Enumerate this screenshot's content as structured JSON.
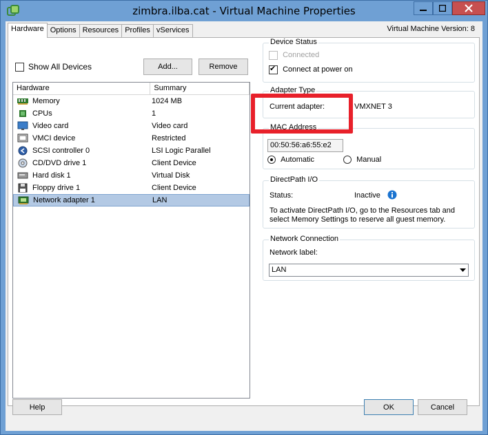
{
  "window": {
    "title": "zimbra.ilba.cat - Virtual Machine Properties",
    "vm_version": "Virtual Machine Version: 8"
  },
  "tabs": [
    {
      "label": "Hardware",
      "active": true
    },
    {
      "label": "Options",
      "active": false
    },
    {
      "label": "Resources",
      "active": false
    },
    {
      "label": "Profiles",
      "active": false
    },
    {
      "label": "vServices",
      "active": false
    }
  ],
  "hardware": {
    "show_all_label": "Show All Devices",
    "show_all_checked": false,
    "add_label": "Add...",
    "remove_label": "Remove",
    "columns": [
      "Hardware",
      "Summary"
    ],
    "devices": [
      {
        "name": "Memory",
        "summary": "1024 MB",
        "icon": "memory-icon"
      },
      {
        "name": "CPUs",
        "summary": "1",
        "icon": "cpu-icon"
      },
      {
        "name": "Video card",
        "summary": "Video card",
        "icon": "video-card-icon"
      },
      {
        "name": "VMCI device",
        "summary": "Restricted",
        "icon": "vmci-icon"
      },
      {
        "name": "SCSI controller 0",
        "summary": "LSI Logic Parallel",
        "icon": "scsi-icon"
      },
      {
        "name": "CD/DVD drive 1",
        "summary": "Client Device",
        "icon": "cd-dvd-icon"
      },
      {
        "name": "Hard disk 1",
        "summary": "Virtual Disk",
        "icon": "hard-disk-icon"
      },
      {
        "name": "Floppy drive 1",
        "summary": "Client Device",
        "icon": "floppy-icon"
      },
      {
        "name": "Network adapter 1",
        "summary": "LAN",
        "icon": "network-adapter-icon",
        "selected": true
      }
    ]
  },
  "device_status": {
    "label": "Device Status",
    "connected_label": "Connected",
    "connected_checked": false,
    "connect_power_label": "Connect at power on",
    "connect_power_checked": true
  },
  "adapter_type": {
    "label": "Adapter Type",
    "current_label": "Current adapter:",
    "current_value": "VMXNET 3"
  },
  "mac_address": {
    "label": "MAC Address",
    "value": "00:50:56:a6:55:e2",
    "automatic_label": "Automatic",
    "manual_label": "Manual",
    "selected": "Automatic"
  },
  "directpath": {
    "label": "DirectPath I/O",
    "status_label": "Status:",
    "status_value": "Inactive",
    "note": "To activate DirectPath I/O, go to the Resources tab and select Memory Settings to reserve all guest memory."
  },
  "network_connection": {
    "label": "Network Connection",
    "network_label": "Network label:",
    "selected_value": "LAN"
  },
  "footer": {
    "help_label": "Help",
    "ok_label": "OK",
    "cancel_label": "Cancel"
  },
  "colors": {
    "titlebar": "#6fa0d4",
    "highlight": "#e8202a",
    "selection": "#b3c9e4",
    "info_icon": "#1a73d0"
  }
}
